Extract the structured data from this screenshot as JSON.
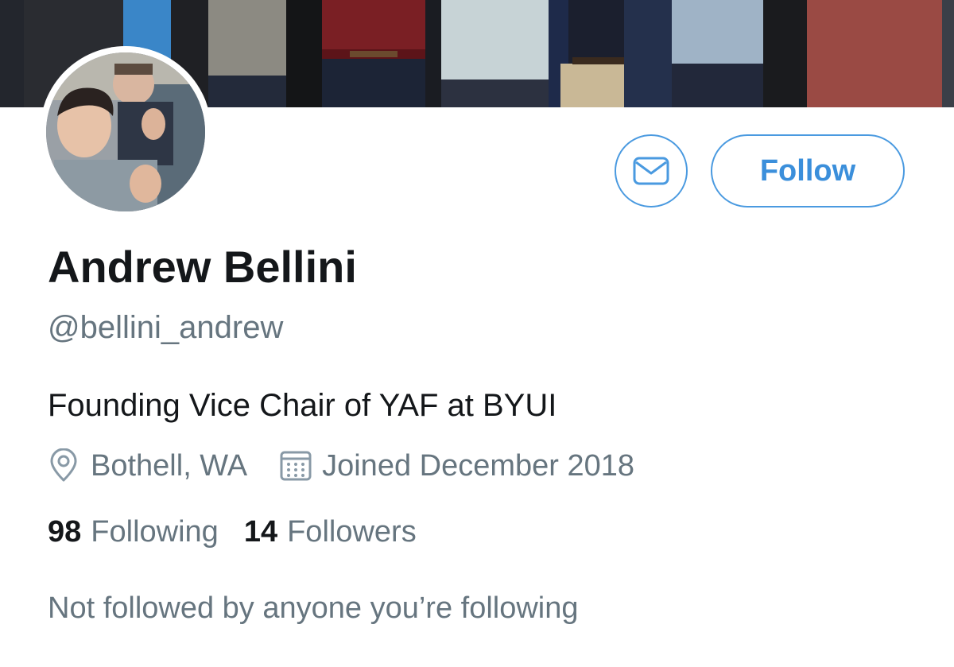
{
  "profile": {
    "display_name": "Andrew Bellini",
    "handle": "@bellini_andrew",
    "bio": "Founding Vice Chair of YAF at BYUI",
    "location": "Bothell, WA",
    "joined": "Joined December 2018",
    "following_count": "98",
    "following_label": "Following",
    "followers_count": "14",
    "followers_label": "Followers",
    "followed_by_note": "Not followed by anyone you’re following"
  },
  "actions": {
    "follow_label": "Follow",
    "message_icon": "envelope-icon"
  },
  "icons": {
    "location": "location-pin-icon",
    "joined": "calendar-icon"
  },
  "colors": {
    "accent": "#4a9ae0",
    "text_primary": "#14171a",
    "text_secondary": "#66757f",
    "background": "#ffffff"
  }
}
